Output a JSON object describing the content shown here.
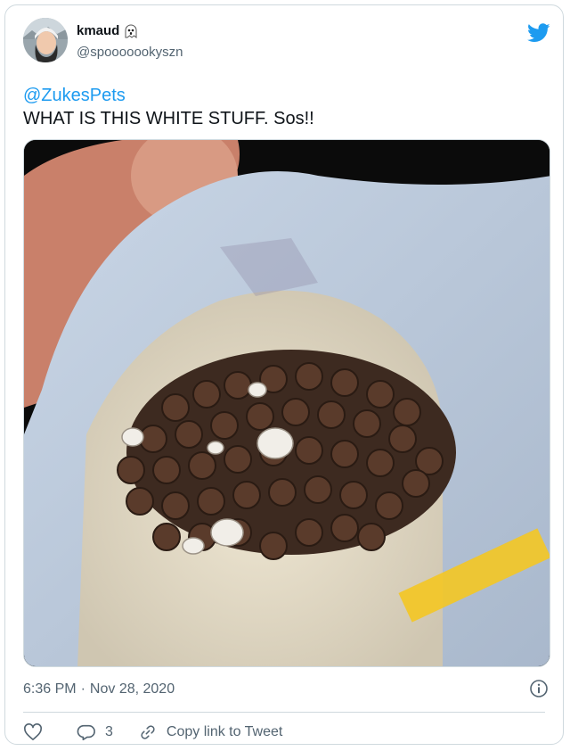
{
  "user": {
    "display_name": "kmaud",
    "handle": "@spooooookyszn",
    "name_emoji_icon": "ghost-icon"
  },
  "tweet": {
    "mention": "@ZukesPets",
    "text": "WHAT IS THIS WHITE STUFF. Sos!!",
    "time": "6:36 PM",
    "separator": "·",
    "date": "Nov 28, 2020"
  },
  "media": {
    "subject": "open treat bag"
  },
  "actions": {
    "reply_count": "3",
    "copy_link_label": "Copy link to Tweet"
  },
  "colors": {
    "accent": "#1d9bf0",
    "secondary_text": "#536471",
    "border": "#cfd9de"
  }
}
